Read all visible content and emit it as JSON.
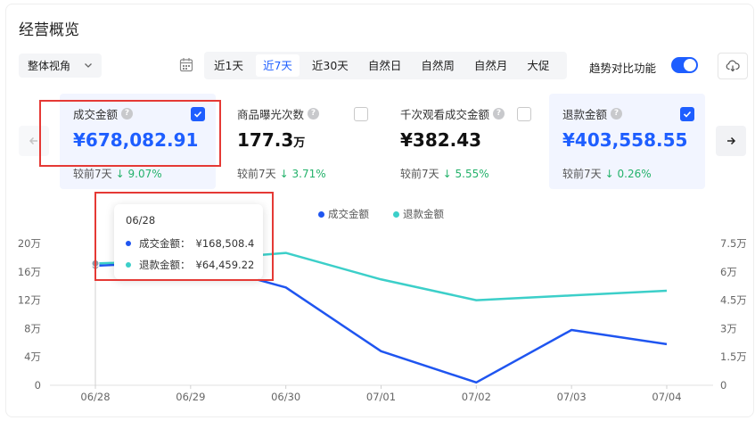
{
  "title": "经营概览",
  "view_select": {
    "value": "整体视角"
  },
  "range_tabs": [
    "近1天",
    "近7天",
    "近30天",
    "自然日",
    "自然周",
    "自然月",
    "大促"
  ],
  "active_range": "近7天",
  "compare": {
    "label": "趋势对比功能",
    "enabled": true
  },
  "metrics": [
    {
      "label": "成交金额",
      "value": "¥678,082.91",
      "unit": "",
      "compare_label": "较前7天",
      "change": "↓ 9.07%",
      "checked": true
    },
    {
      "label": "商品曝光次数",
      "value": "177.3",
      "unit": "万",
      "compare_label": "较前7天",
      "change": "↓ 3.71%",
      "checked": false
    },
    {
      "label": "千次观看成交金额",
      "value": "¥382.43",
      "unit": "",
      "compare_label": "较前7天",
      "change": "↓ 5.55%",
      "checked": false
    },
    {
      "label": "退款金额",
      "value": "¥403,558.55",
      "unit": "",
      "compare_label": "较前7天",
      "change": "↓ 0.26%",
      "checked": true
    }
  ],
  "tooltip": {
    "date": "06/28",
    "rows": [
      {
        "label": "成交金额：",
        "value": "¥168,508.4"
      },
      {
        "label": "退款金额：",
        "value": "¥64,459.22"
      }
    ]
  },
  "colors": {
    "accent": "#1e5eff",
    "gmv_line": "#1f55f0",
    "refund_line": "#3ccfc9",
    "down": "#24b26b",
    "annotation": "#e53935"
  },
  "chart_data": {
    "type": "line",
    "categories": [
      "06/28",
      "06/29",
      "06/30",
      "07/01",
      "07/02",
      "07/03",
      "07/04"
    ],
    "series": [
      {
        "name": "成交金额",
        "axis": "left",
        "values": [
          168508.4,
          175000,
          138000,
          48000,
          4000,
          78000,
          58000
        ]
      },
      {
        "name": "退款金额",
        "axis": "right",
        "values": [
          64459.22,
          66000,
          70000,
          56000,
          45000,
          47500,
          50000
        ]
      }
    ],
    "y_left": {
      "ylim": [
        0,
        200000
      ],
      "ticks": [
        "0",
        "4万",
        "8万",
        "12万",
        "16万",
        "20万"
      ]
    },
    "y_right": {
      "ylim": [
        0,
        75000
      ],
      "ticks": [
        "0",
        "1.5万",
        "3万",
        "4.5万",
        "6万",
        "7.5万"
      ]
    },
    "legend_position": "top-center",
    "grid": false
  }
}
